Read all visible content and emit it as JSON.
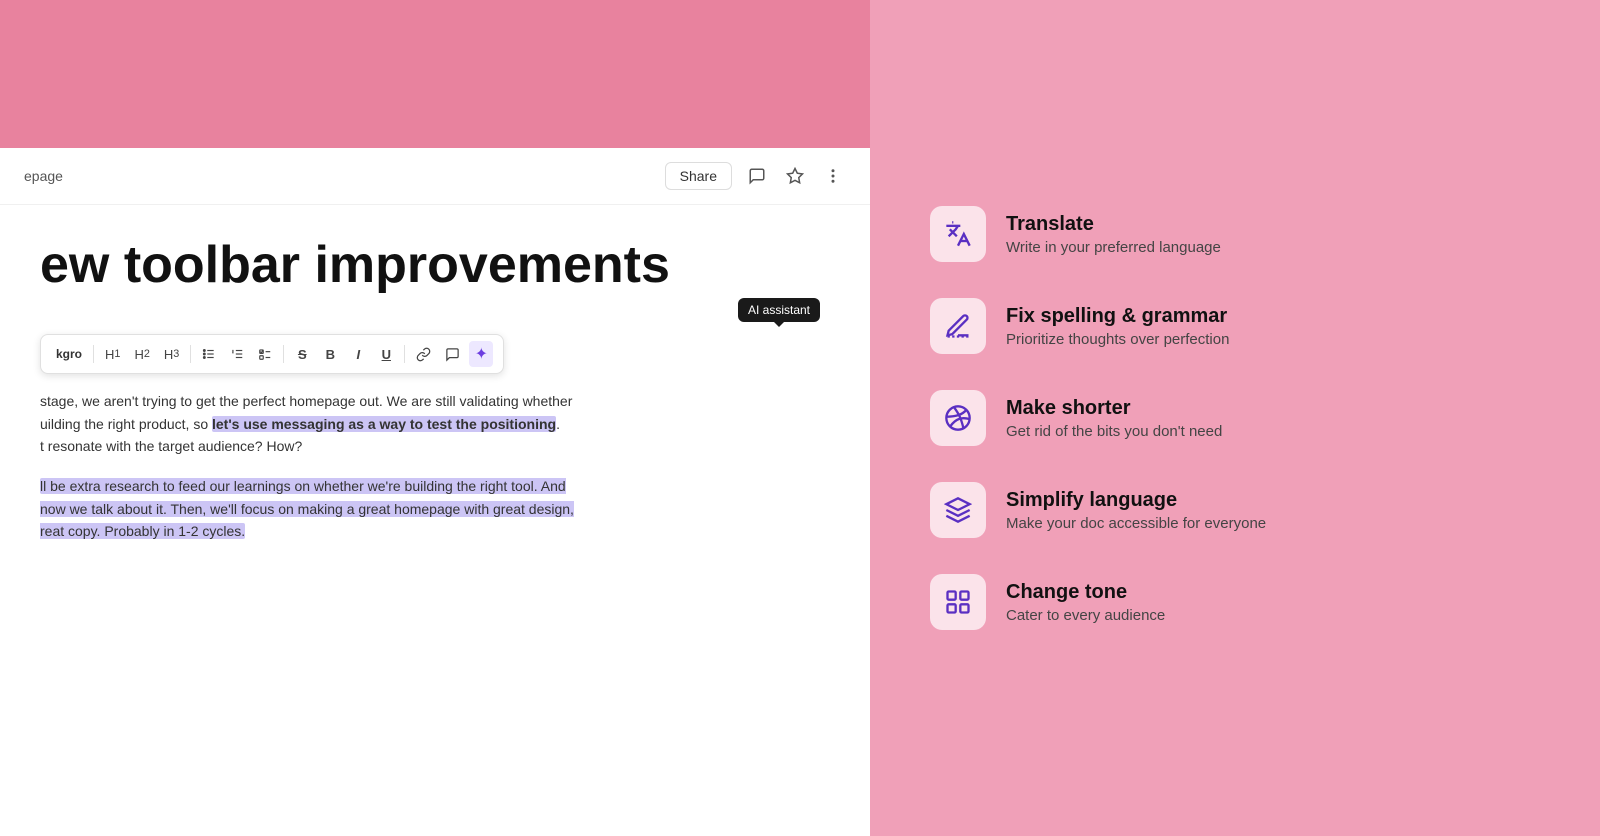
{
  "colors": {
    "pink_bg": "#f0a0b8",
    "pink_top": "#e8829e",
    "accent_purple": "#5a2fc2",
    "highlight_bg": "#ccc5f5"
  },
  "header": {
    "breadcrumb": "epage",
    "share_label": "Share"
  },
  "document": {
    "title": "ew toolbar improvements",
    "paragraph1_pre": "stage, we aren't trying to get the perfect homepage out. We are still validating whether",
    "paragraph1_mid_pre": "uilding the right product, so ",
    "paragraph1_bold": "let's use messaging as a way to test the positioning",
    "paragraph1_mid_post": ".",
    "paragraph1_post": "t resonate with the target audience? How?",
    "paragraph2": "ll be extra research to feed our learnings on whether we're building the right tool. And\nnow we talk about it. Then, we'll focus on making a great homepage with great design,\nreat copy. Probably in 1-2 cycles."
  },
  "toolbar": {
    "items": [
      {
        "id": "text-label",
        "label": "kgro",
        "type": "label"
      },
      {
        "id": "h1",
        "label": "H₁",
        "type": "button"
      },
      {
        "id": "h2",
        "label": "H₂",
        "type": "button"
      },
      {
        "id": "h3",
        "label": "H₃",
        "type": "button"
      },
      {
        "id": "bullet-list",
        "label": "☰",
        "type": "button"
      },
      {
        "id": "ordered-list",
        "label": "≡",
        "type": "button"
      },
      {
        "id": "checklist",
        "label": "☑",
        "type": "button"
      },
      {
        "id": "strikethrough",
        "label": "S̶",
        "type": "button"
      },
      {
        "id": "bold",
        "label": "B",
        "type": "button"
      },
      {
        "id": "italic",
        "label": "I",
        "type": "button"
      },
      {
        "id": "underline",
        "label": "U",
        "type": "button"
      },
      {
        "id": "link",
        "label": "🔗",
        "type": "button"
      },
      {
        "id": "comment",
        "label": "💬",
        "type": "button"
      },
      {
        "id": "ai",
        "label": "✦",
        "type": "button",
        "active": true
      }
    ],
    "ai_tooltip": "AI assistant"
  },
  "features": [
    {
      "id": "translate",
      "icon": "🌐",
      "title": "Translate",
      "desc": "Write in your preferred language"
    },
    {
      "id": "fix-spelling",
      "icon": "✏",
      "title": "Fix spelling & grammar",
      "desc": "Prioritize thoughts over perfection"
    },
    {
      "id": "make-shorter",
      "icon": "✂",
      "title": "Make shorter",
      "desc": "Get rid of the bits you don't need"
    },
    {
      "id": "simplify-language",
      "icon": "◆",
      "title": "Simplify language",
      "desc": "Make your doc accessible for everyone"
    },
    {
      "id": "change-tone",
      "icon": "⊞",
      "title": "Change tone",
      "desc": "Cater to every audience"
    }
  ]
}
